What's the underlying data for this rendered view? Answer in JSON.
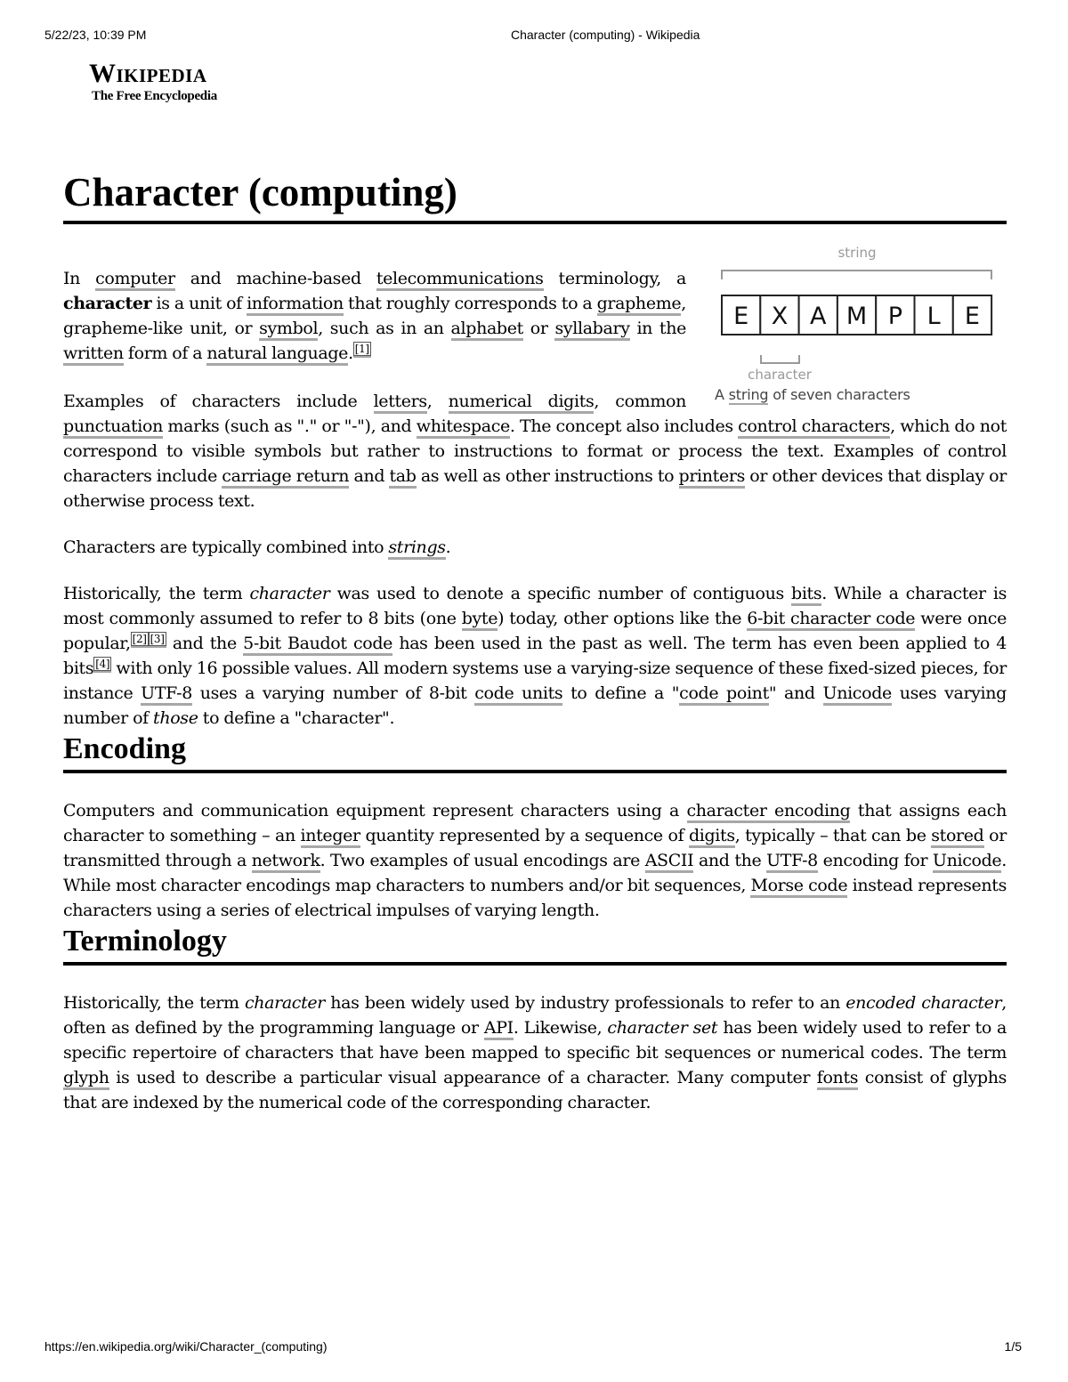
{
  "print_header": {
    "datetime": "5/22/23, 10:39 PM",
    "page_title": "Character (computing) - Wikipedia"
  },
  "print_footer": {
    "url": "https://en.wikipedia.org/wiki/Character_(computing)",
    "page_number": "1/5"
  },
  "logo": {
    "wordmark": "Wikipedia",
    "tagline": "The Free Encyclopedia"
  },
  "article": {
    "title": "Character (computing)",
    "figure": {
      "string_label": "string",
      "letters": [
        "E",
        "X",
        "A",
        "M",
        "P",
        "L",
        "E"
      ],
      "character_label": "character",
      "caption_prefix": "A ",
      "caption_link": "string",
      "caption_suffix": " of seven characters"
    },
    "intro": {
      "p1": {
        "t0": "In ",
        "l_computer": "computer",
        "t1": " and machine-based ",
        "l_telecom": "telecommunications",
        "t2": " terminology, a ",
        "b_character": "character",
        "t3": " is a unit of ",
        "l_information": "information",
        "t4": " that roughly corresponds to a ",
        "l_grapheme": "grapheme",
        "t5": ", grapheme-like unit, or ",
        "l_symbol": "symbol",
        "t6": ", such as in an ",
        "l_alphabet": "alphabet",
        "t7": " or ",
        "l_syllabary": "syllabary",
        "t8": " in the ",
        "l_written": "written",
        "t9": " form of a ",
        "l_natural_language": "natural language",
        "t10": ".",
        "ref1": "[1]"
      },
      "p2": {
        "t0": "Examples of characters include ",
        "l_letters": "letters",
        "t1": ", ",
        "l_numerical_digits": "numerical digits",
        "t2": ", common ",
        "l_punctuation": "punctuation",
        "t3": " marks (such as \".\" or \"-\"), and ",
        "l_whitespace": "whitespace",
        "t4": ". The concept also includes ",
        "l_control_characters": "control characters",
        "t5": ", which do not correspond to visible symbols but rather to instructions to format or process the text. Examples of control characters include ",
        "l_carriage_return": "carriage return",
        "t6": " and ",
        "l_tab": "tab",
        "t7": " as well as other instructions to ",
        "l_printers": "printers",
        "t8": " or other devices that display or otherwise process text."
      },
      "p3": {
        "t0": "Characters are typically combined into ",
        "l_strings": "strings",
        "t1": "."
      },
      "p4": {
        "t0": "Historically, the term ",
        "i_character": "character",
        "t1": " was used to denote a specific number of contiguous ",
        "l_bits": "bits",
        "t2": ". While a character is most commonly assumed to refer to 8 bits (one ",
        "l_byte": "byte",
        "t3": ") today, other options like the ",
        "l_6bit": "6-bit character code",
        "t4": " were once popular,",
        "ref2": "[2]",
        "ref3": "[3]",
        "t5": " and the ",
        "l_baudot": "5-bit Baudot code",
        "t6": " has been used in the past as well. The term has even been applied to 4 bits",
        "ref4": "[4]",
        "t7": " with only 16 possible values. All modern systems use a varying-size sequence of these fixed-sized pieces, for instance ",
        "l_utf8": "UTF-8",
        "t8": " uses a varying number of 8-bit ",
        "l_code_units": "code units",
        "t9": " to define a \"",
        "l_code_point": "code point",
        "t10": "\" and ",
        "l_unicode": "Unicode",
        "t11": " uses varying number of ",
        "i_those": "those",
        "t12": " to define a \"character\"."
      }
    },
    "sections": [
      {
        "heading": "Encoding",
        "p": {
          "t0": "Computers and communication equipment represent characters using a ",
          "l_character_encoding": "character encoding",
          "t1": " that assigns each character to something – an ",
          "l_integer": "integer",
          "t2": " quantity represented by a sequence of ",
          "l_digits": "digits",
          "t3": ", typically – that can be ",
          "l_stored": "stored",
          "t4": " or transmitted through a ",
          "l_network": "network",
          "t5": ". Two examples of usual encodings are ",
          "l_ascii": "ASCII",
          "t6": " and the ",
          "l_utf8": "UTF-8",
          "t7": " encoding for ",
          "l_unicode": "Unicode",
          "t8": ". While most character encodings map characters to numbers and/or bit sequences, ",
          "l_morse": "Morse code",
          "t9": " instead represents characters using a series of electrical impulses of varying length."
        }
      },
      {
        "heading": "Terminology",
        "p": {
          "t0": "Historically, the term ",
          "i_character": "character",
          "t1": " has been widely used by industry professionals to refer to an ",
          "i_encoded_character": "encoded character",
          "t2": ", often as defined by the programming language or ",
          "l_api": "API",
          "t3": ". Likewise, ",
          "i_character_set": "character set",
          "t4": " has been widely used to refer to a specific repertoire of characters that have been mapped to specific bit sequences or numerical codes. The term ",
          "l_glyph": "glyph",
          "t5": " is used to describe a particular visual appearance of a character. Many computer ",
          "l_fonts": "fonts",
          "t6": " consist of glyphs that are indexed by the numerical code of the corresponding character."
        }
      }
    ]
  },
  "colors": {
    "link_underline": "#a7a7a7",
    "caption_text": "#444444",
    "figure_label": "#999999"
  }
}
